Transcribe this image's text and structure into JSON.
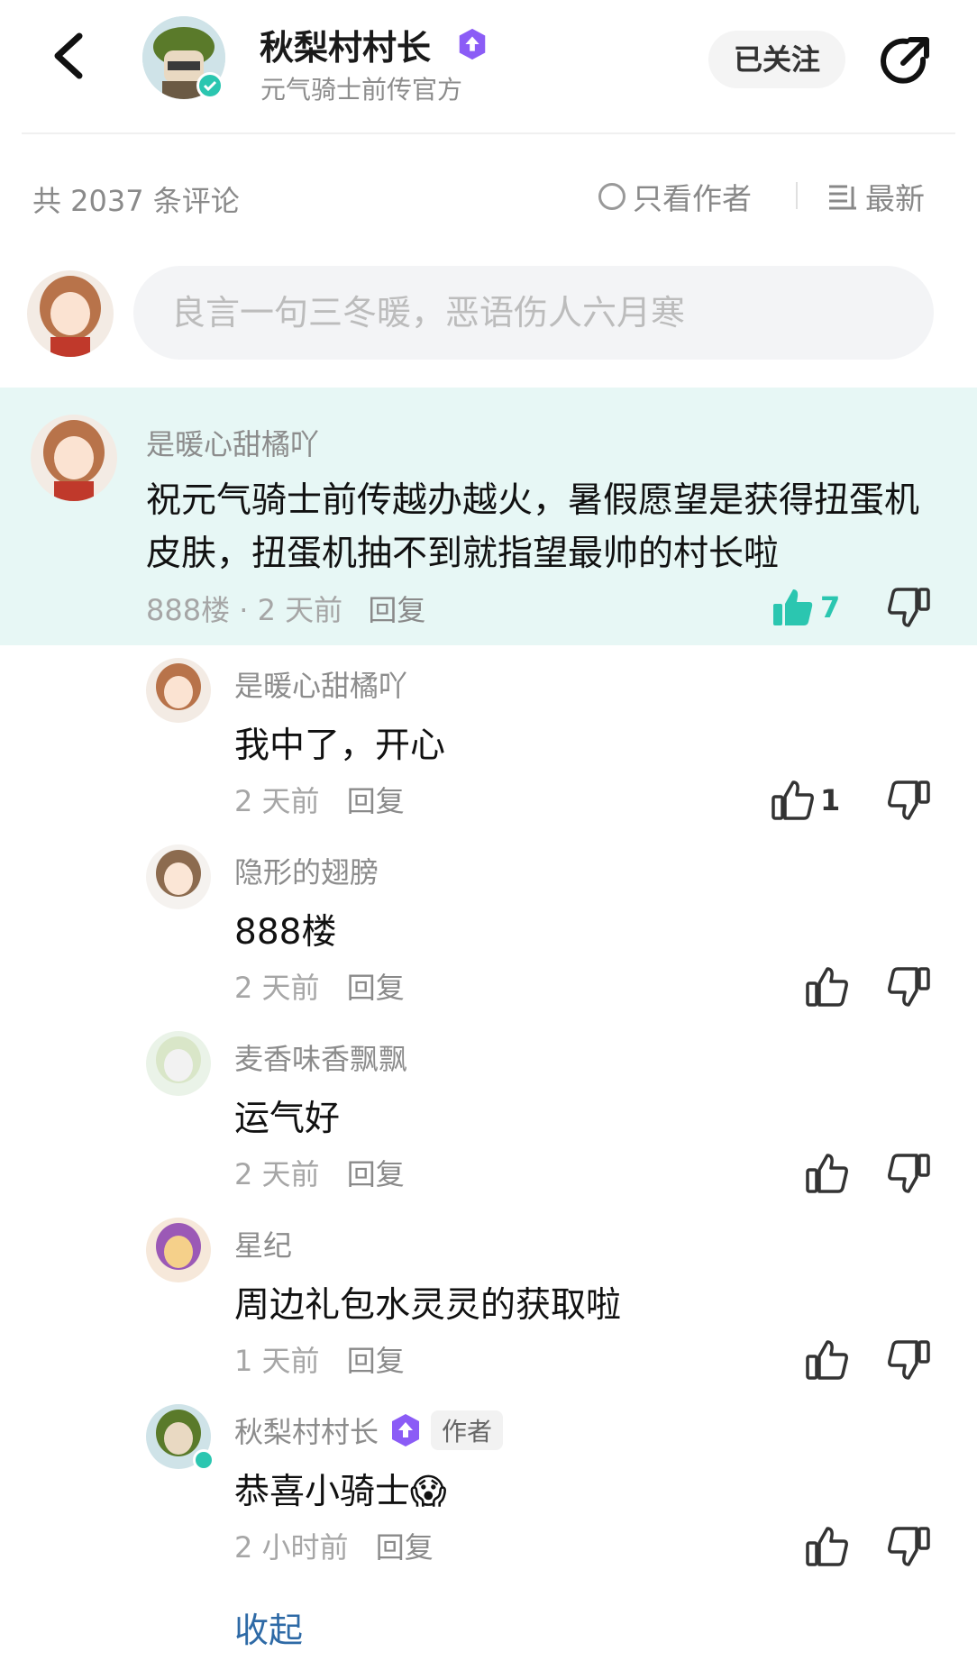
{
  "header": {
    "name": "秋梨村村长",
    "subtitle": "元气骑士前传官方",
    "follow_label": "已关注"
  },
  "filter": {
    "count_text": "共 2037 条评论",
    "only_author_label": "只看作者",
    "sort_label": "最新"
  },
  "composer": {
    "placeholder": "良言一句三冬暖，恶语伤人六月寒"
  },
  "main_comment": {
    "user": "是暖心甜橘吖",
    "text": "祝元气骑士前传越办越火，暑假愿望是获得扭蛋机皮肤，扭蛋机抽不到就指望最帅的村长啦",
    "floor": "888楼",
    "time": "2 天前",
    "reply_label": "回复",
    "likes": "7",
    "liked": true
  },
  "replies": [
    {
      "user": "是暖心甜橘吖",
      "text": "我中了，开心",
      "time": "2 天前",
      "reply_label": "回复",
      "likes": "1"
    },
    {
      "user": "隐形的翅膀",
      "text": "888楼",
      "time": "2 天前",
      "reply_label": "回复",
      "likes": ""
    },
    {
      "user": "麦香味香飘飘",
      "text": "运气好",
      "time": "2 天前",
      "reply_label": "回复",
      "likes": ""
    },
    {
      "user": "星纪",
      "text": "周边礼包水灵灵的获取啦",
      "time": "1 天前",
      "reply_label": "回复",
      "likes": ""
    },
    {
      "user": "秋梨村村长",
      "author_tag": "作者",
      "text": "恭喜小骑士",
      "emoji": "😱",
      "time": "2 小时前",
      "reply_label": "回复",
      "likes": ""
    }
  ],
  "collapse_label": "收起",
  "colors": {
    "accent": "#2bc6b0",
    "highlight_bg": "#e7f7f5",
    "badge": "#8b5cf6",
    "link": "#2e6aa6"
  }
}
